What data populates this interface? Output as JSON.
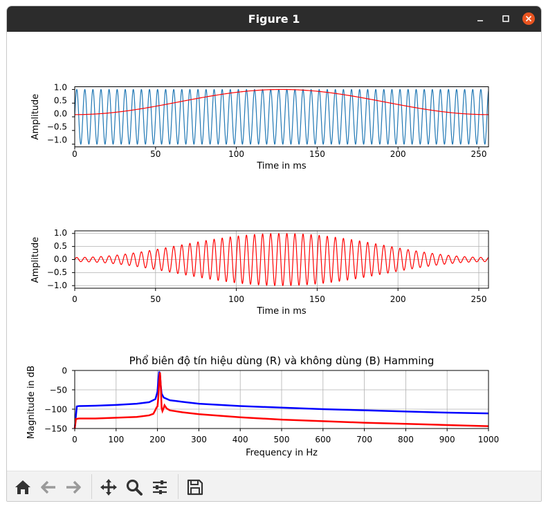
{
  "window": {
    "title": "Figure 1"
  },
  "toolbar": {
    "icons": [
      "home-icon",
      "back-icon",
      "forward-icon",
      "pan-icon",
      "zoom-icon",
      "configure-subplots-icon",
      "save-icon"
    ]
  },
  "plots": {
    "p1": {
      "ylabel": "Amplitude",
      "xlabel": "Time in ms",
      "yticks": [
        "1.0",
        "0.5",
        "0.0",
        "−0.5",
        "−1.0"
      ],
      "xticks": [
        "0",
        "50",
        "100",
        "150",
        "200",
        "250"
      ]
    },
    "p2": {
      "ylabel": "Amplitude",
      "xlabel": "Time in ms",
      "yticks": [
        "1.0",
        "0.5",
        "0.0",
        "−0.5",
        "−1.0"
      ],
      "xticks": [
        "0",
        "50",
        "100",
        "150",
        "200",
        "250"
      ]
    },
    "p3": {
      "title": "Phổ biên độ tín hiệu dùng (R) và không dùng (B) Hamming",
      "ylabel": "Magnitude in dB",
      "xlabel": "Frequency in Hz",
      "yticks": [
        "0",
        "−50",
        "−100",
        "−150"
      ],
      "xticks": [
        "0",
        "100",
        "200",
        "300",
        "400",
        "500",
        "600",
        "700",
        "800",
        "900",
        "1000"
      ]
    }
  },
  "chart_data": [
    {
      "type": "line",
      "xlabel": "Time in ms",
      "ylabel": "Amplitude",
      "xlim": [
        0,
        256
      ],
      "ylim": [
        -1.1,
        1.1
      ],
      "grid": false,
      "series": [
        {
          "color": "#1f77b4",
          "function": "sine",
          "frequency_hz": 200,
          "amplitude": 1.0
        },
        {
          "color": "#ff0000",
          "function": "hamming window",
          "min": 0.08,
          "max": 1.0
        }
      ]
    },
    {
      "type": "line",
      "xlabel": "Time in ms",
      "ylabel": "Amplitude",
      "xlim": [
        0,
        256
      ],
      "ylim": [
        -1.1,
        1.1
      ],
      "grid": true,
      "series": [
        {
          "color": "#ff0000",
          "function": "sine × hamming window",
          "frequency_hz": 200
        }
      ]
    },
    {
      "type": "line",
      "title": "Phổ biên độ tín hiệu dùng (R) và không dùng (B) Hamming",
      "xlabel": "Frequency in Hz",
      "ylabel": "Magnitude in dB",
      "xlim": [
        0,
        1000
      ],
      "ylim": [
        -150,
        0
      ],
      "grid": true,
      "series": [
        {
          "color": "#0000ff",
          "x": [
            0,
            5,
            10,
            50,
            100,
            150,
            180,
            195,
            200,
            202,
            204,
            206,
            208,
            210,
            215,
            230,
            260,
            300,
            400,
            500,
            600,
            700,
            800,
            900,
            1000
          ],
          "y": [
            -150,
            -93,
            -92,
            -91,
            -89,
            -86,
            -82,
            -74,
            -55,
            -25,
            -3,
            -8,
            -40,
            -60,
            -70,
            -77,
            -81,
            -86,
            -92,
            -96,
            -100,
            -103,
            -106,
            -109,
            -111
          ]
        },
        {
          "color": "#ff0000",
          "x": [
            0,
            3,
            6,
            10,
            50,
            100,
            150,
            180,
            190,
            195,
            198,
            200,
            202,
            204,
            206,
            208,
            210,
            212,
            214,
            217,
            222,
            230,
            260,
            300,
            400,
            500,
            600,
            700,
            800,
            900,
            1000
          ],
          "y": [
            -150,
            -125,
            -125,
            -124,
            -124,
            -122,
            -120,
            -116,
            -112,
            -102,
            -95,
            -93,
            -70,
            -30,
            -5,
            -40,
            -97,
            -105,
            -100,
            -90,
            -98,
            -103,
            -108,
            -113,
            -121,
            -127,
            -131,
            -135,
            -138,
            -141,
            -144
          ]
        }
      ]
    }
  ]
}
